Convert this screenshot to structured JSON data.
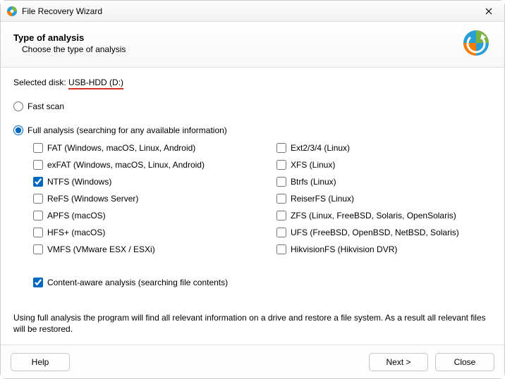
{
  "window": {
    "title": "File Recovery Wizard"
  },
  "header": {
    "heading": "Type of analysis",
    "subheading": "Choose the type of analysis"
  },
  "selected_disk": {
    "label": "Selected disk: ",
    "value": "USB-HDD (D:)"
  },
  "scan": {
    "fast_label": "Fast scan",
    "fast_selected": false,
    "full_label": "Full analysis (searching for any available information)",
    "full_selected": true
  },
  "filesystems": {
    "left": [
      {
        "label": "FAT (Windows, macOS, Linux, Android)",
        "checked": false
      },
      {
        "label": "exFAT (Windows, macOS, Linux, Android)",
        "checked": false
      },
      {
        "label": "NTFS (Windows)",
        "checked": true
      },
      {
        "label": "ReFS (Windows Server)",
        "checked": false
      },
      {
        "label": "APFS (macOS)",
        "checked": false
      },
      {
        "label": "HFS+ (macOS)",
        "checked": false
      },
      {
        "label": "VMFS (VMware ESX / ESXi)",
        "checked": false
      }
    ],
    "right": [
      {
        "label": "Ext2/3/4 (Linux)",
        "checked": false
      },
      {
        "label": "XFS (Linux)",
        "checked": false
      },
      {
        "label": "Btrfs (Linux)",
        "checked": false
      },
      {
        "label": "ReiserFS (Linux)",
        "checked": false
      },
      {
        "label": "ZFS (Linux, FreeBSD, Solaris, OpenSolaris)",
        "checked": false
      },
      {
        "label": "UFS (FreeBSD, OpenBSD, NetBSD, Solaris)",
        "checked": false
      },
      {
        "label": "HikvisionFS (Hikvision DVR)",
        "checked": false
      }
    ]
  },
  "content_aware": {
    "label": "Content-aware analysis (searching file contents)",
    "checked": true
  },
  "description": "Using full analysis the program will find all relevant information on a drive and restore a file system. As a result all relevant files will be restored.",
  "buttons": {
    "help": "Help",
    "next": "Next >",
    "close": "Close"
  }
}
